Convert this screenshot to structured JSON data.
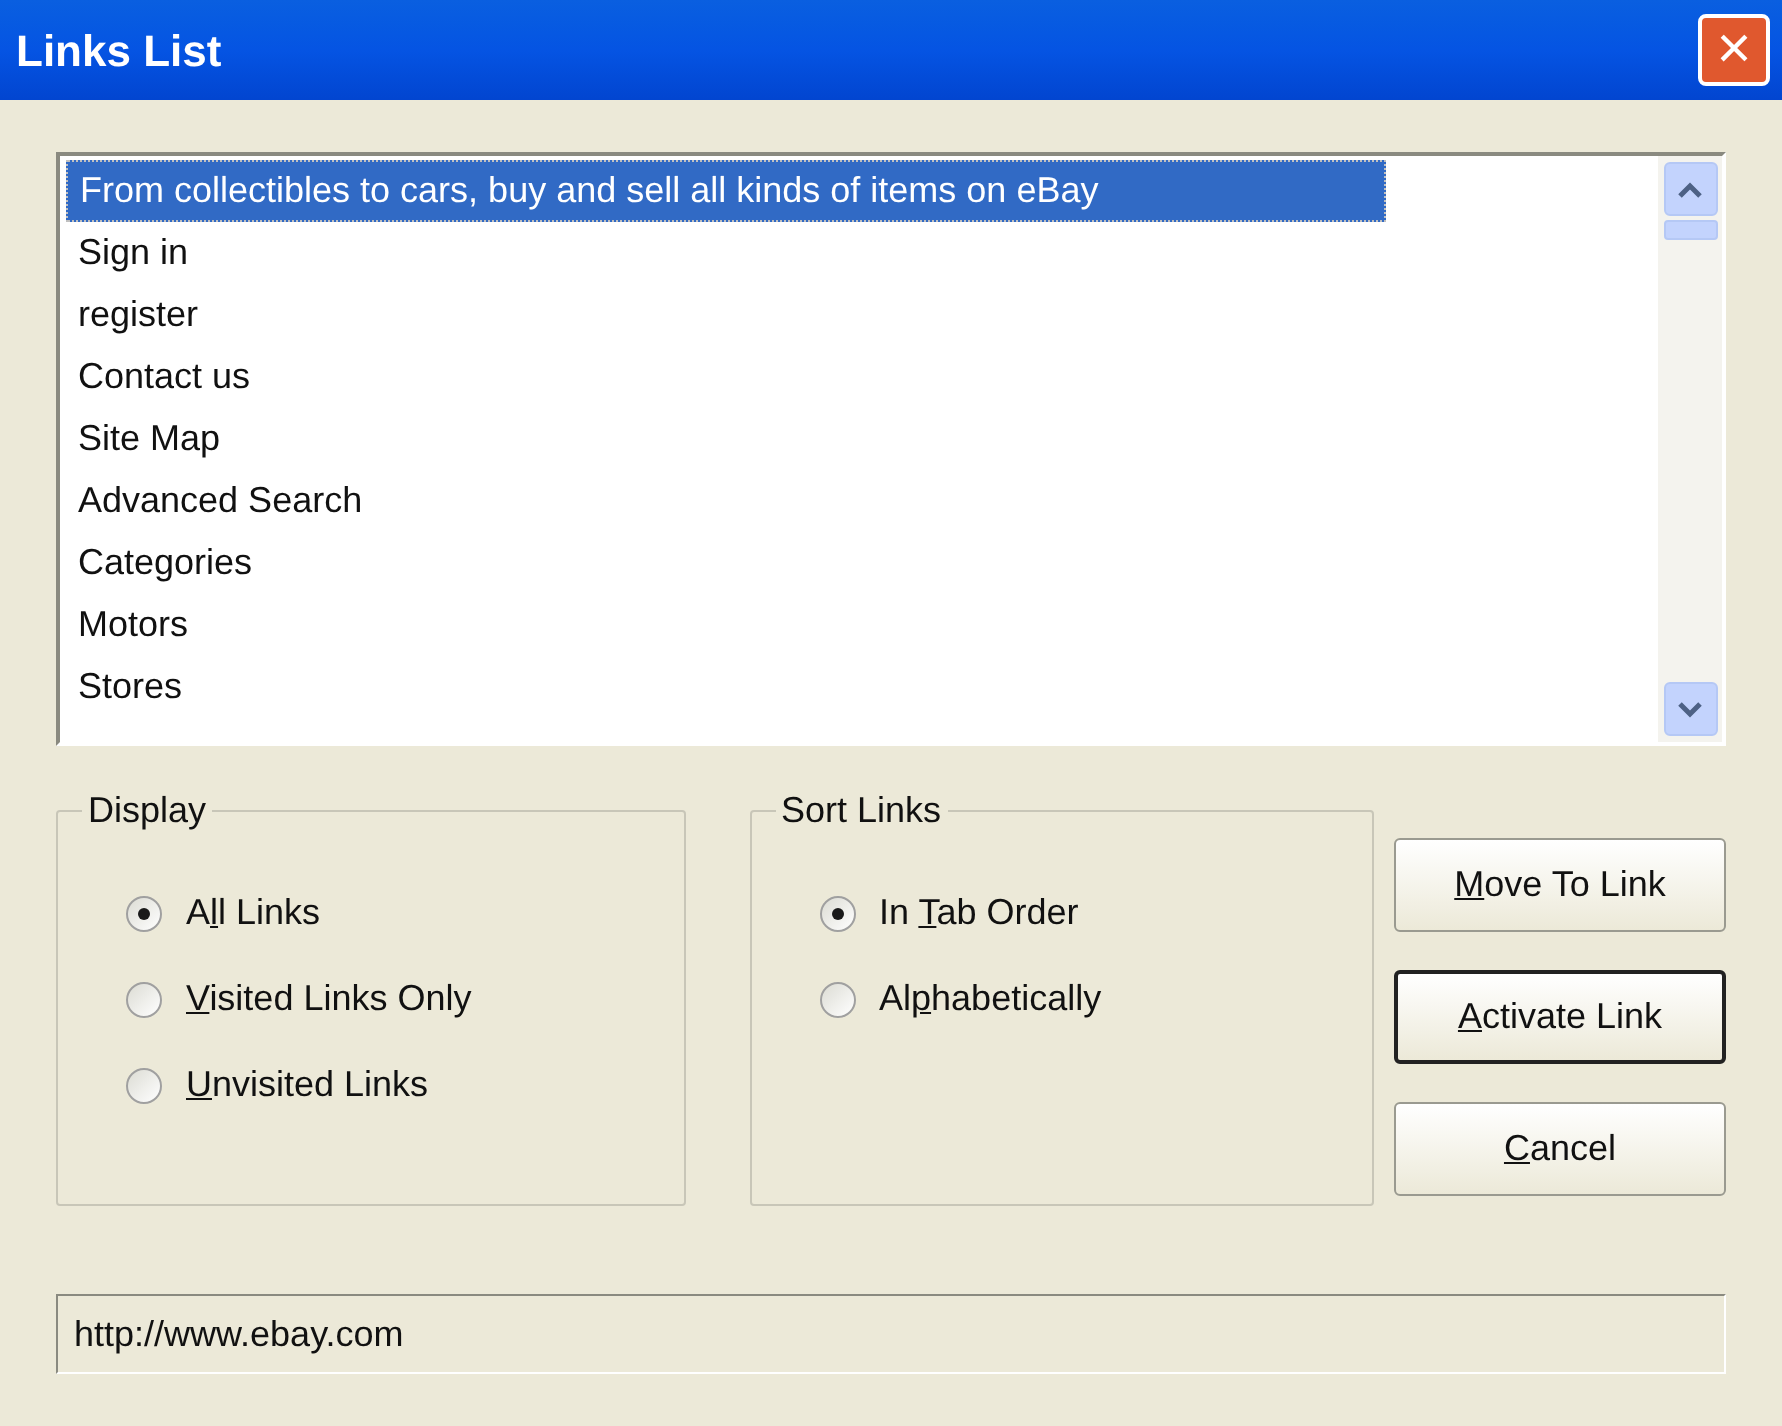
{
  "window": {
    "title": "Links List",
    "close": "×"
  },
  "links": [
    {
      "label": "From collectibles to cars, buy and sell all kinds of items on eBay",
      "selected": true
    },
    {
      "label": "Sign in",
      "selected": false
    },
    {
      "label": "register",
      "selected": false
    },
    {
      "label": "Contact us",
      "selected": false
    },
    {
      "label": "Site Map",
      "selected": false
    },
    {
      "label": "Advanced Search",
      "selected": false
    },
    {
      "label": "Categories",
      "selected": false
    },
    {
      "label": "Motors",
      "selected": false
    },
    {
      "label": "Stores",
      "selected": false
    }
  ],
  "display": {
    "title": "Display",
    "options": [
      {
        "pre": "A",
        "key": "l",
        "post": "l Links",
        "selected": true
      },
      {
        "key": "V",
        "post": "isited Links Only",
        "selected": false
      },
      {
        "key": "U",
        "post": "nvisited Links",
        "selected": false
      }
    ]
  },
  "sort_links": {
    "title": "Sort Links",
    "options": [
      {
        "pre": "In ",
        "key": "T",
        "post": "ab Order",
        "selected": true
      },
      {
        "pre": "Al",
        "key": "p",
        "post": "habetically",
        "selected": false
      }
    ]
  },
  "buttons": [
    {
      "key": "M",
      "post": "ove To Link",
      "default": false
    },
    {
      "key": "A",
      "post": "ctivate Link",
      "default": true
    },
    {
      "key": "C",
      "post": "ancel",
      "default": false
    }
  ],
  "status": {
    "value": "http://www.ebay.com"
  }
}
